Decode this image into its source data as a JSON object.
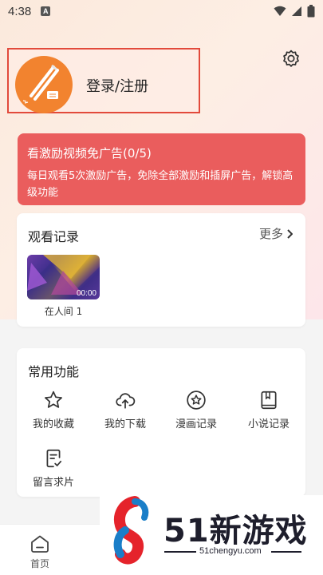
{
  "status_bar": {
    "time": "4:38",
    "notification_glyph": "A"
  },
  "user": {
    "login_label": "登录/注册"
  },
  "promo": {
    "title": "看激励视频免广告(0/5)",
    "description": "每日观看5次激励广告，免除全部激励和插屏广告，解锁高级功能"
  },
  "history": {
    "title": "观看记录",
    "more_label": "更多",
    "items": [
      {
        "title": "在人间 1",
        "duration": "00:00"
      }
    ]
  },
  "functions": {
    "title": "常用功能",
    "items": [
      {
        "label": "我的收藏",
        "icon": "star-icon"
      },
      {
        "label": "我的下载",
        "icon": "cloud-upload-icon"
      },
      {
        "label": "漫画记录",
        "icon": "star-circle-icon"
      },
      {
        "label": "小说记录",
        "icon": "book-icon"
      },
      {
        "label": "留言求片",
        "icon": "note-icon"
      }
    ]
  },
  "tabbar": {
    "home_label": "首页"
  },
  "watermark": {
    "name": "51新游戏",
    "url": "51chengyu.com"
  },
  "colors": {
    "accent_red": "#ea5d5d",
    "highlight_border": "#e24a3b",
    "avatar_orange": "#f2832f"
  }
}
